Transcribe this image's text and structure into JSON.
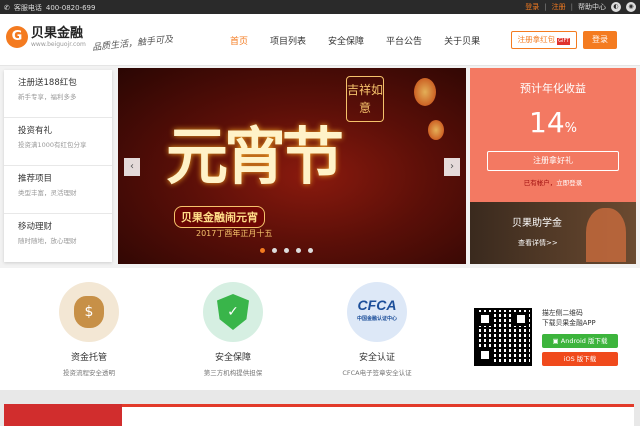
{
  "topbar": {
    "phone_label": "客服电话",
    "phone": "400-0820-699",
    "login": "登录",
    "sep": "|",
    "register": "注册",
    "help": "帮助中心"
  },
  "header": {
    "logo_name": "贝果金融",
    "logo_url": "www.beiguojr.com",
    "slogan": "品质生活，触手可及",
    "nav": [
      "首页",
      "项目列表",
      "安全保障",
      "平台公告",
      "关于贝果"
    ],
    "register_btn": "注册拿红包",
    "gift": "GIFT",
    "login_btn": "登录"
  },
  "sidebar": {
    "items": [
      {
        "title": "注册送188红包",
        "desc": "新手专享，福利多多"
      },
      {
        "title": "投资有礼",
        "desc": "投资满1000有红包分享"
      },
      {
        "title": "推荐项目",
        "desc": "类型丰富，灵活理财"
      },
      {
        "title": "移动理财",
        "desc": "随时随地，放心理财"
      }
    ]
  },
  "banner": {
    "headline": "元宵节",
    "seal": "吉祥如意",
    "subtitle": "贝果金融闹元宵",
    "date": "2017丁酉年正月十五",
    "prev": "‹",
    "next": "›",
    "dots": 5,
    "active_dot": 0
  },
  "yield_box": {
    "label": "预计年化收益",
    "value": "14",
    "unit": "%",
    "cta": "注册拿好礼",
    "account_text": "已有帐户，",
    "account_link": "立即登录"
  },
  "help_card": {
    "title": "贝果助学金",
    "more": "查看详情>>"
  },
  "features": [
    {
      "title": "资金托管",
      "desc": "投资流程安全透明",
      "icon": "money-bag-icon"
    },
    {
      "title": "安全保障",
      "desc": "第三方机构提供担保",
      "icon": "shield-check-icon"
    },
    {
      "title": "安全认证",
      "desc": "CFCA电子签章安全认证",
      "icon": "cfca-logo-icon"
    }
  ],
  "cfca": {
    "text": "CFCA",
    "sub": "中国金融认证中心"
  },
  "app": {
    "line1": "描左侧二维码",
    "line2": "下载贝果金融APP",
    "android": "Android 版下载",
    "ios": "iOS 版下载",
    "android_color": "#3cb43c",
    "ios_color": "#f04a1c"
  },
  "colors": {
    "accent": "#f47b20",
    "yield_bg": "#f37962"
  }
}
